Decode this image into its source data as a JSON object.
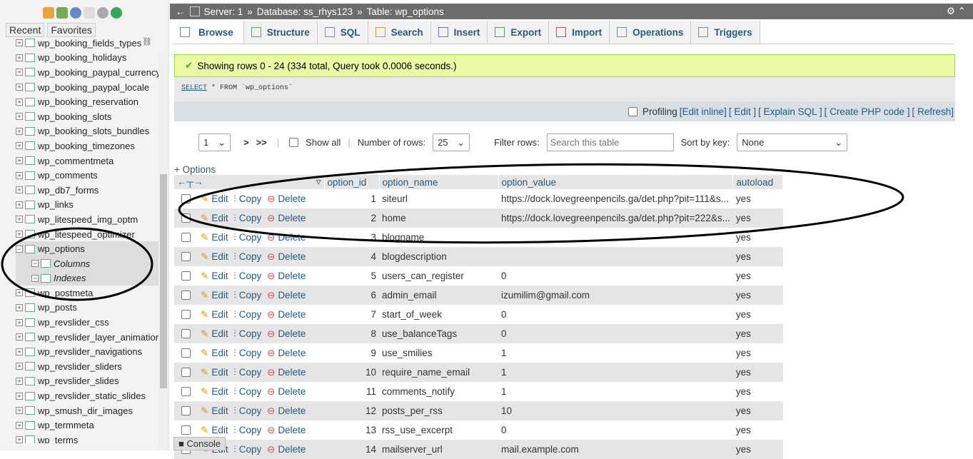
{
  "sidebar": {
    "recent": "Recent",
    "favorites": "Favorites",
    "tables": [
      "wp_booking_fields_types",
      "wp_booking_holidays",
      "wp_booking_paypal_currency",
      "wp_booking_paypal_locale",
      "wp_booking_reservation",
      "wp_booking_slots",
      "wp_booking_slots_bundles",
      "wp_booking_timezones",
      "wp_commentmeta",
      "wp_comments",
      "wp_db7_forms",
      "wp_links",
      "wp_litespeed_img_optm",
      "wp_litespeed_optimizer",
      "wp_options"
    ],
    "sub": [
      "Columns",
      "Indexes"
    ],
    "tables_after": [
      "wp_postmeta",
      "wp_posts",
      "wp_revslider_css",
      "wp_revslider_layer_animations",
      "wp_revslider_navigations",
      "wp_revslider_sliders",
      "wp_revslider_slides",
      "wp_revslider_static_slides",
      "wp_smush_dir_images",
      "wp_termmeta",
      "wp_terms"
    ]
  },
  "breadcrumb": {
    "server": "Server: 1",
    "database": "Database: ss_rhys123",
    "table": "Table: wp_options",
    "sep": "»"
  },
  "tabs": [
    "Browse",
    "Structure",
    "SQL",
    "Search",
    "Insert",
    "Export",
    "Import",
    "Operations",
    "Triggers"
  ],
  "message": "Showing rows 0 - 24 (334 total, Query took 0.0006 seconds.)",
  "sql": {
    "kw1": "SELECT",
    "rest": " * FROM `wp_options`"
  },
  "profiling": {
    "label": "Profiling",
    "links": [
      "[Edit inline]",
      "[ Edit ]",
      "[ Explain SQL ]",
      "[ Create PHP code ]",
      "[ Refresh]"
    ]
  },
  "nav": {
    "page": "1",
    "next": ">",
    "last": ">>",
    "show_all": "Show all",
    "rows_label": "Number of rows:",
    "rows": "25",
    "filter_label": "Filter rows:",
    "filter_placeholder": "Search this table",
    "sort_label": "Sort by key:",
    "sort": "None"
  },
  "options_link": "+ Options",
  "columns": [
    "option_id",
    "option_name",
    "option_value",
    "autoload"
  ],
  "actions": {
    "edit": "Edit",
    "copy": "Copy",
    "delete": "Delete"
  },
  "rows": [
    [
      "1",
      "siteurl",
      "https://dock.lovegreenpencils.ga/det.php?pit=111&s...",
      "yes"
    ],
    [
      "2",
      "home",
      "https://dock.lovegreenpencils.ga/det.php?pit=222&s...",
      "yes"
    ],
    [
      "3",
      "blogname",
      "",
      "yes"
    ],
    [
      "4",
      "blogdescription",
      "",
      "yes"
    ],
    [
      "5",
      "users_can_register",
      "0",
      "yes"
    ],
    [
      "6",
      "admin_email",
      "izumilim@gmail.com",
      "yes"
    ],
    [
      "7",
      "start_of_week",
      "0",
      "yes"
    ],
    [
      "8",
      "use_balanceTags",
      "0",
      "yes"
    ],
    [
      "9",
      "use_smilies",
      "1",
      "yes"
    ],
    [
      "10",
      "require_name_email",
      "1",
      "yes"
    ],
    [
      "11",
      "comments_notify",
      "1",
      "yes"
    ],
    [
      "12",
      "posts_per_rss",
      "10",
      "yes"
    ],
    [
      "13",
      "rss_use_excerpt",
      "0",
      "yes"
    ],
    [
      "14",
      "mailserver_url",
      "mail.example.com",
      "yes"
    ]
  ],
  "console": "Console"
}
